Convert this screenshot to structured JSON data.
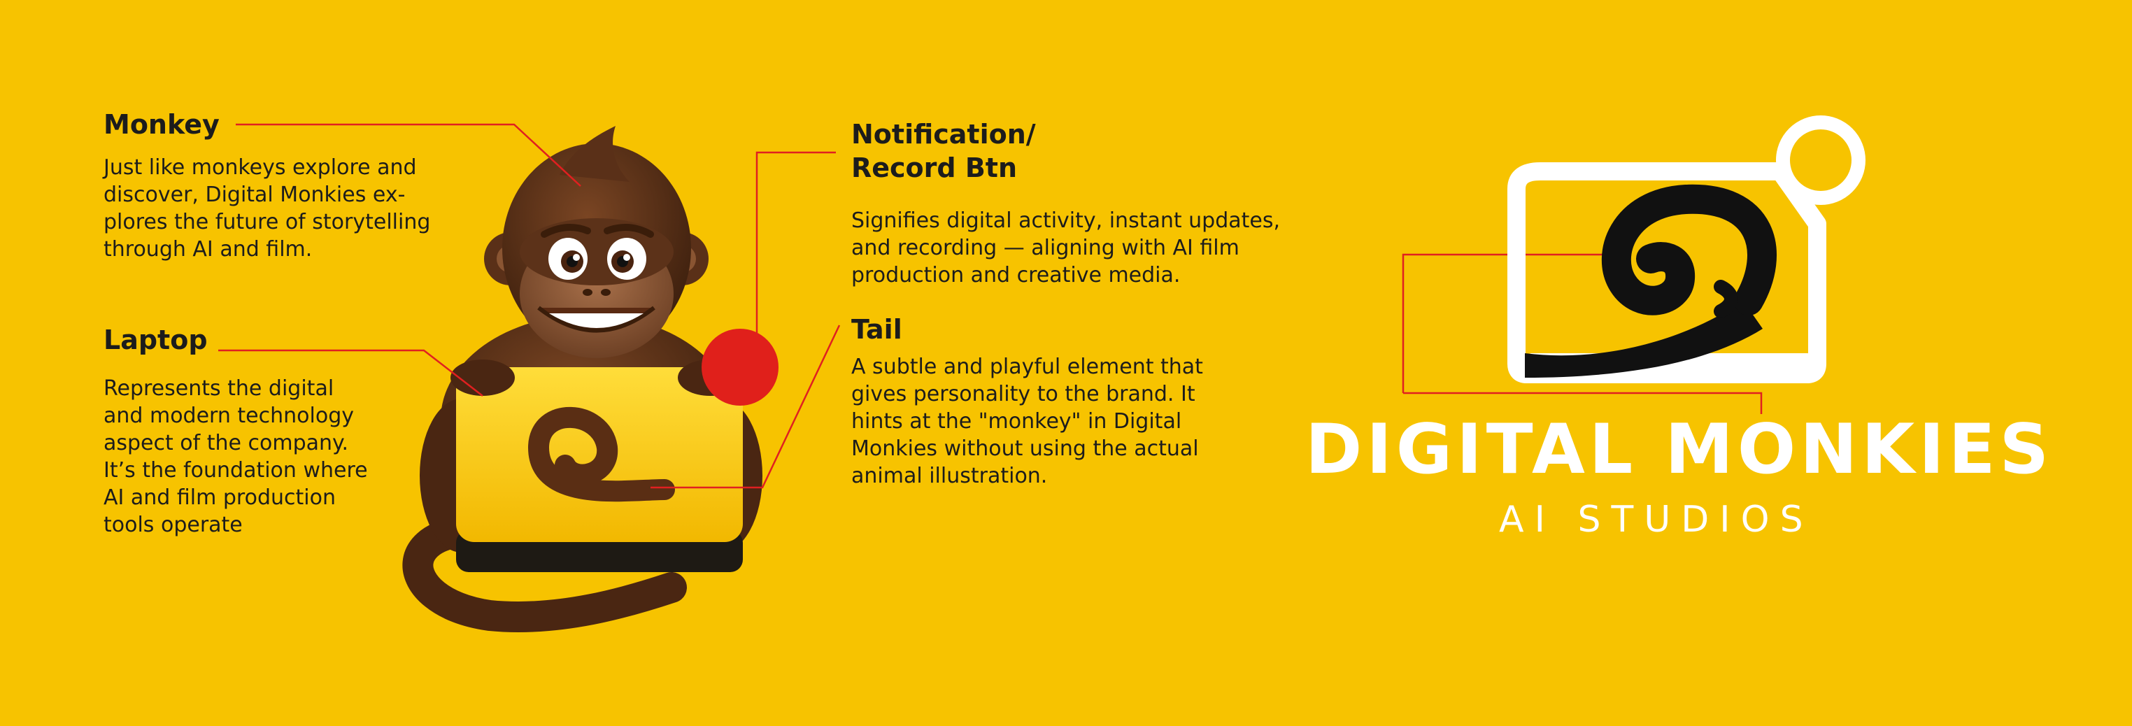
{
  "callouts": {
    "monkey": {
      "title": "Monkey",
      "description": "Just like monkeys explore and\ndiscover, Digital Monkies ex-\nplores the future of storytelling\nthrough AI and film."
    },
    "laptop": {
      "title": "Laptop",
      "description": "Represents the digital\nand modern technology\naspect of the company.\nIt’s the foundation where\nAI and film production\ntools operate"
    },
    "notification": {
      "title": "Notification/\nRecord Btn",
      "description": "Signifies digital activity, instant updates,\nand recording — aligning with AI film\nproduction and creative media."
    },
    "tail": {
      "title": "Tail",
      "description": "A subtle and playful element that\ngives personality to the brand. It\nhints at the \"monkey\" in Digital\nMonkies without using the actual\nanimal illustration."
    }
  },
  "logo": {
    "wordmark": "DIGITAL MONKIES",
    "subtitle": "AI STUDIOS",
    "icon": "laptop-with-tail-and-record-dot"
  },
  "colors": {
    "background": "#F7C300",
    "text": "#1c1c1c",
    "leader_line": "#E02020",
    "record_dot": "#E0201B",
    "monkey_brown": "#5A3018",
    "laptop_yellow": "#FFD21F",
    "logo_white": "#FFFFFF",
    "logo_black": "#111111"
  }
}
